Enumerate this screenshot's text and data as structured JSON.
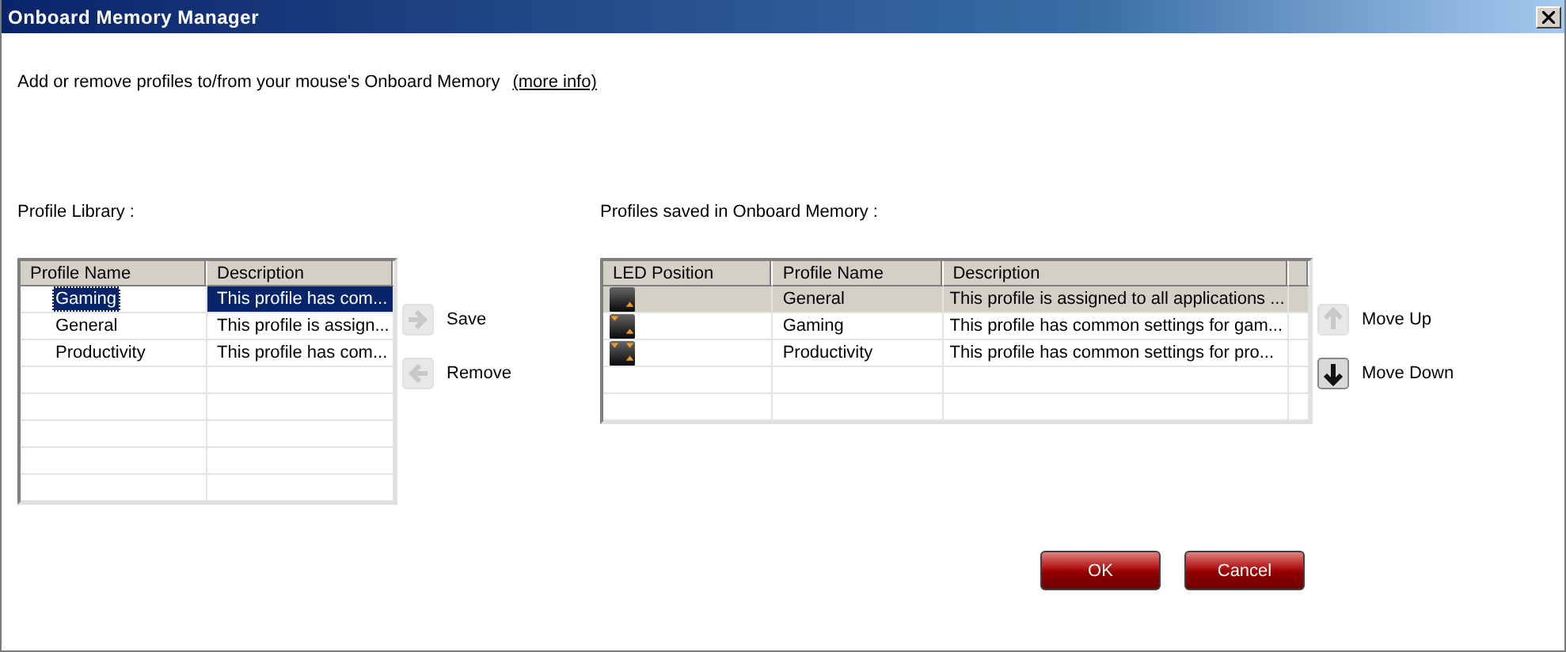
{
  "window": {
    "title": "Onboard Memory Manager"
  },
  "intro": {
    "text": "Add or remove profiles to/from your mouse's Onboard Memory",
    "link": "(more info)"
  },
  "library": {
    "label": "Profile Library :",
    "columns": [
      "Profile Name",
      "Description"
    ],
    "rows": [
      {
        "name": "Gaming",
        "description": "This profile has com...",
        "selected": true
      },
      {
        "name": "General",
        "description": "This profile is assign...",
        "selected": false
      },
      {
        "name": "Productivity",
        "description": "This profile has com...",
        "selected": false
      }
    ]
  },
  "transfer_buttons": [
    {
      "label": "Save",
      "kind": "right",
      "disabled": true
    },
    {
      "label": "Remove",
      "kind": "left",
      "disabled": true
    }
  ],
  "memory": {
    "label": "Profiles saved in Onboard Memory :",
    "columns": [
      "LED Position",
      "Profile Name",
      "Description"
    ],
    "rows": [
      {
        "kind": "one-led",
        "name": "General",
        "description": "This profile is assigned to all applications ...",
        "selected": true
      },
      {
        "kind": "two-leds",
        "name": "Gaming",
        "description": "This profile has common settings for gam...",
        "selected": false
      },
      {
        "kind": "three-leds",
        "name": "Productivity",
        "description": "This profile has common settings for pro...",
        "selected": false
      }
    ]
  },
  "order_buttons": [
    {
      "label": "Move Up",
      "kind": "up",
      "disabled": true
    },
    {
      "label": "Move Down",
      "kind": "down",
      "disabled": false
    }
  ],
  "dialog_buttons": [
    "OK",
    "Cancel"
  ]
}
